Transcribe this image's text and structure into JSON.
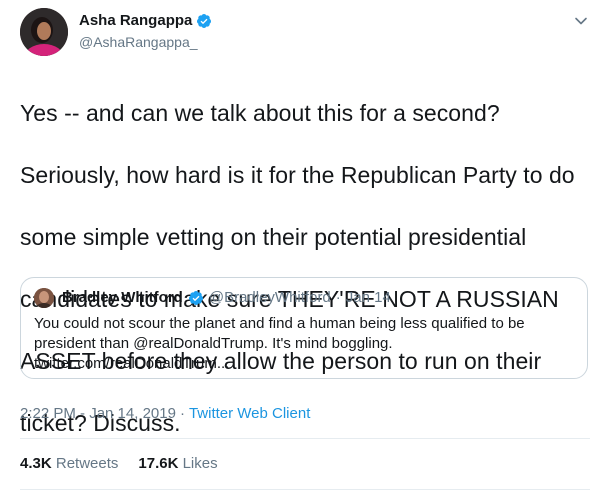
{
  "tweet": {
    "author": {
      "name": "Asha Rangappa",
      "handle": "@AshaRangappa_",
      "verified_icon": "verified-badge-icon"
    },
    "text_lines": [
      "Yes -- and can we talk about this for a second?",
      "Seriously, how hard is it for the Republican Party to do",
      "some simple vetting on their potential presidential",
      "candidates to make sure THEY'RE NOT A RUSSIAN",
      "ASSET before they allow the person to run on their",
      "ticket? Discuss."
    ],
    "quoted": {
      "name": "Bradley Whitford",
      "handle": "@BradleyWhitford",
      "separator": "·",
      "date": "Jan 14",
      "text_lines": [
        "You could not scour the planet and find a human being less qualified to be",
        "president than @realDonaldTrump.  It's mind boggling.",
        "twitter.com/realDonaldTrum..."
      ]
    },
    "timestamp": "2:22 PM - Jan 14, 2019",
    "separator": "·",
    "source": "Twitter Web Client",
    "stats": {
      "retweets_count": "4.3K",
      "retweets_label": "Retweets",
      "likes_count": "17.6K",
      "likes_label": "Likes"
    }
  },
  "colors": {
    "text": "#14171a",
    "secondary": "#657786",
    "link": "#1b95e0",
    "verified": "#1da1f2",
    "border": "#ccd6dd"
  }
}
